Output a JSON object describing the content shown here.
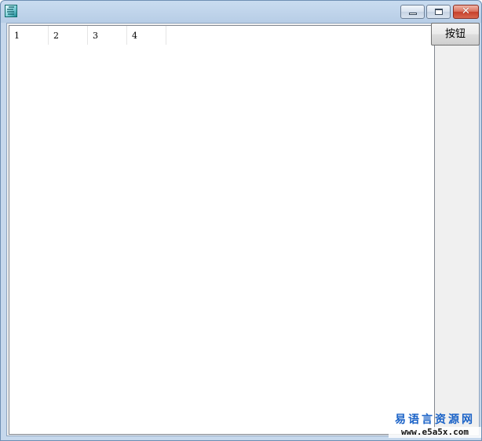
{
  "window": {
    "title": "",
    "icon": "app-icon"
  },
  "listview": {
    "columns": [
      "1",
      "2",
      "3",
      "4"
    ]
  },
  "action_button": {
    "label": "按钮"
  },
  "watermark": {
    "chinese": "易语言资源网",
    "url": "www.e5a5x.com"
  },
  "colors": {
    "title_gradient_top": "#c9dcf0",
    "close_button": "#c7402b",
    "watermark_blue": "#1a62c7"
  }
}
